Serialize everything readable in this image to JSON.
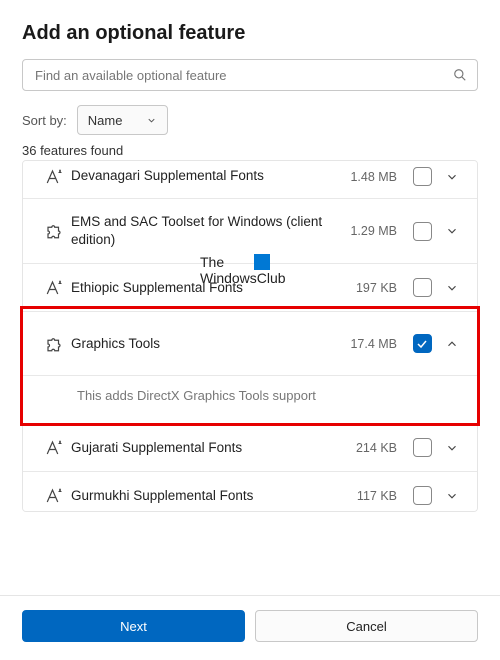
{
  "title": "Add an optional feature",
  "search": {
    "placeholder": "Find an available optional feature"
  },
  "sort": {
    "label": "Sort by:",
    "value": "Name"
  },
  "results_count": "36 features found",
  "features": [
    {
      "icon": "font",
      "name": "Devanagari Supplemental Fonts",
      "size": "1.48 MB",
      "checked": false,
      "expanded": false
    },
    {
      "icon": "puzzle",
      "name": "EMS and SAC Toolset for Windows (client edition)",
      "size": "1.29 MB",
      "checked": false,
      "expanded": false
    },
    {
      "icon": "font",
      "name": "Ethiopic Supplemental Fonts",
      "size": "197 KB",
      "checked": false,
      "expanded": false
    },
    {
      "icon": "puzzle",
      "name": "Graphics Tools",
      "size": "17.4 MB",
      "checked": true,
      "expanded": true,
      "description": "This adds DirectX Graphics Tools support"
    },
    {
      "icon": "font",
      "name": "Gujarati Supplemental Fonts",
      "size": "214 KB",
      "checked": false,
      "expanded": false
    },
    {
      "icon": "font",
      "name": "Gurmukhi Supplemental Fonts",
      "size": "117 KB",
      "checked": false,
      "expanded": false
    }
  ],
  "buttons": {
    "primary": "Next",
    "secondary": "Cancel"
  },
  "watermark": {
    "line1": "The",
    "line2": "WindowsClub"
  }
}
